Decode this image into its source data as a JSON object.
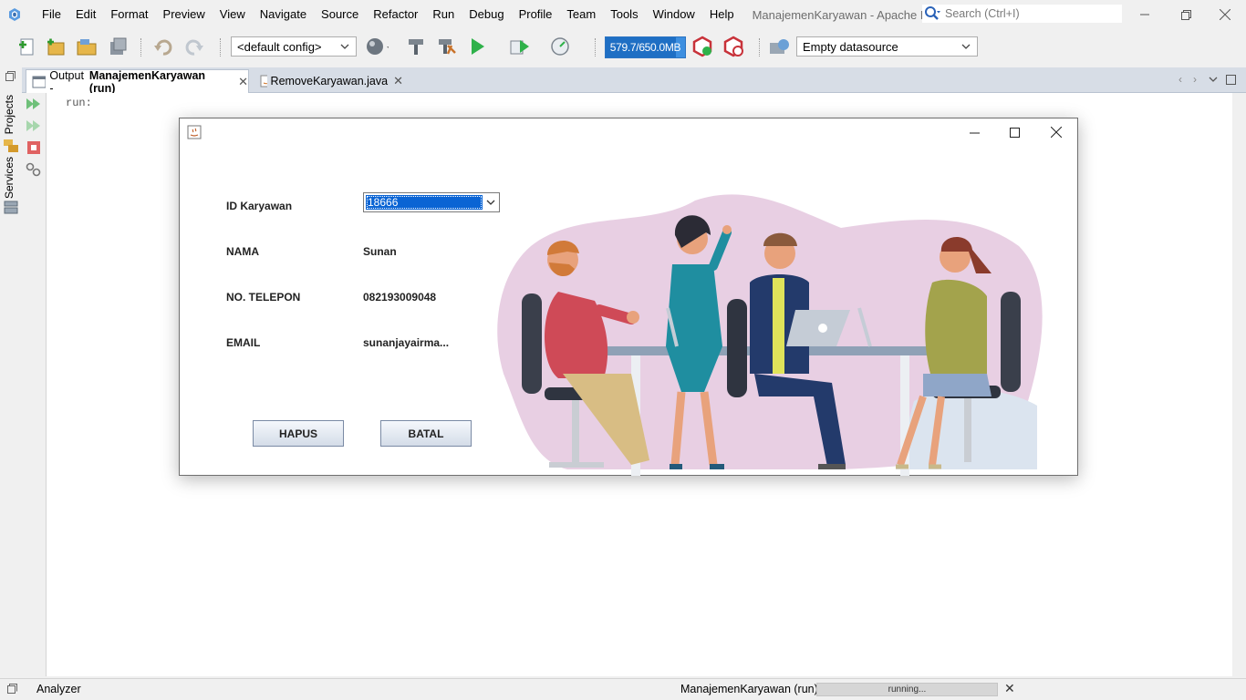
{
  "menubar": {
    "items": [
      "File",
      "Edit",
      "Format",
      "Preview",
      "View",
      "Navigate",
      "Source",
      "Refactor",
      "Run",
      "Debug",
      "Profile",
      "Team",
      "Tools",
      "Window",
      "Help"
    ],
    "window_title": "ManajemenKaryawan - Apache NetBeans...",
    "search_placeholder": "Search (Ctrl+I)"
  },
  "toolbar": {
    "config_select": "<default config>",
    "memory_label": "579.7/650.0MB",
    "memory_used_fraction": 0.89,
    "datasource_select": "Empty datasource"
  },
  "side_tabs": {
    "projects": "Projects",
    "services": "Services"
  },
  "tabs": [
    {
      "prefix": "Output - ",
      "name": "ManajemenKaryawan (run)",
      "active": true
    },
    {
      "name": "RemoveKaryawan.java",
      "active": false
    }
  ],
  "output": {
    "text": "run:"
  },
  "dialog": {
    "id_label": "ID Karyawan",
    "id_value": "18666",
    "name_label": "NAMA",
    "name_value": "Sunan",
    "phone_label": "NO. TELEPON",
    "phone_value": "082193009048",
    "email_label": "EMAIL",
    "email_value": "sunanjayairma...",
    "delete_button": "HAPUS",
    "cancel_button": "BATAL"
  },
  "statusbar": {
    "analyzer": "Analyzer",
    "run_label": "ManajemenKaryawan (run)",
    "progress_text": "running..."
  },
  "colors": {
    "accent": "#0a64d4",
    "memory_bar": "#3d8fe0",
    "tab_bar": "#d7dde6",
    "illustration_blob": "#e8cfe3"
  }
}
